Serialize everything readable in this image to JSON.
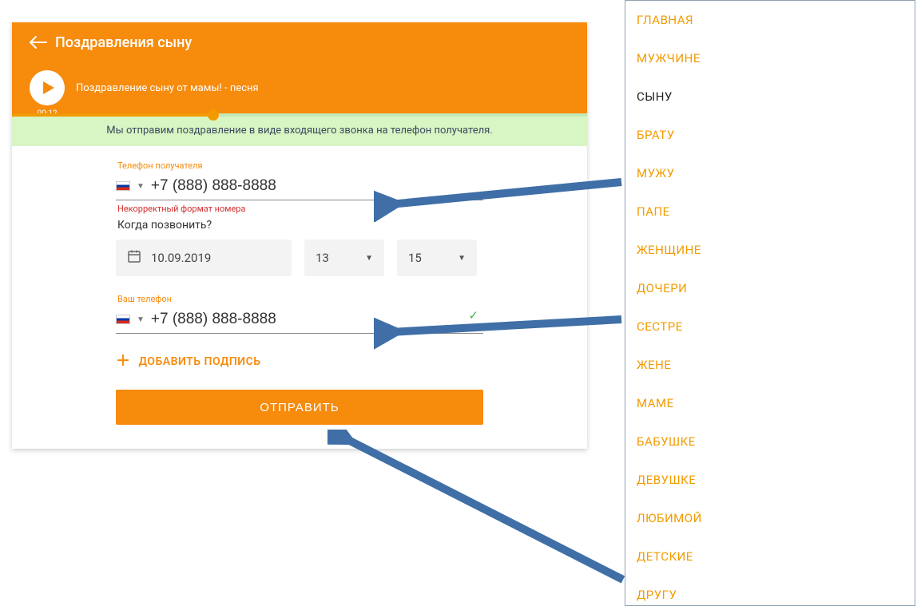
{
  "header": {
    "title": "Поздравления сыну",
    "track": "Поздравление сыну от мамы! - песня",
    "time": "00:12"
  },
  "info": "Мы отправим поздравление в виде входящего звонка на телефон получателя.",
  "recipient": {
    "label": "Телефон получателя",
    "phone": "+7 (888) 888-8888",
    "error": "Некорректный формат номера"
  },
  "when": {
    "label": "Когда позвонить?",
    "date": "10.09.2019",
    "hour": "13",
    "minute": "15"
  },
  "caller": {
    "label": "Ваш телефон",
    "phone": "+7 (888) 888-8888"
  },
  "add_sign": "ДОБАВИТЬ ПОДПИСЬ",
  "send": "ОТПРАВИТЬ",
  "sidebar": {
    "items": [
      "ГЛАВНАЯ",
      "МУЖЧИНЕ",
      "СЫНУ",
      "БРАТУ",
      "МУЖУ",
      "ПАПЕ",
      "ЖЕНЩИНЕ",
      "ДОЧЕРИ",
      "СЕСТРЕ",
      "ЖЕНЕ",
      "МАМЕ",
      "БАБУШКЕ",
      "ДЕВУШКЕ",
      "ЛЮБИМОЙ",
      "ДЕТСКИЕ",
      "ДРУГУ"
    ],
    "active_index": 2
  }
}
